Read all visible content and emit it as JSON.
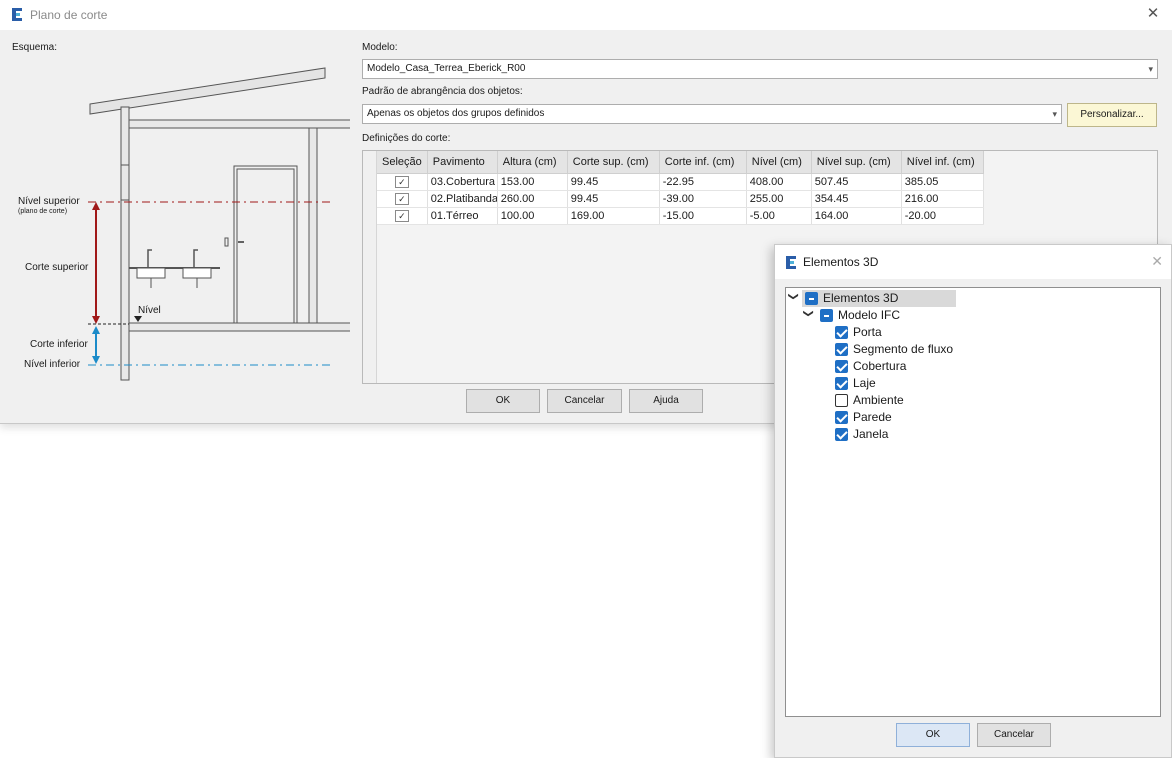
{
  "window": {
    "title": "Plano de corte",
    "close_glyph": "✕"
  },
  "schema": {
    "label": "Esquema:",
    "nivel_superior": "Nível superior",
    "plano_de_corte": "(plano de corte)",
    "corte_superior": "Corte superior",
    "nivel": "Nível",
    "corte_inferior": "Corte inferior",
    "nivel_inferior": "Nível inferior",
    "colors": {
      "superior": "#a01818",
      "inferior": "#1b8bc9"
    }
  },
  "modelo": {
    "label": "Modelo:",
    "value": "Modelo_Casa_Terrea_Eberick_R00"
  },
  "padrao": {
    "label": "Padrão de abrangência dos objetos:",
    "value": "Apenas os objetos dos grupos definidos",
    "personalizar": "Personalizar..."
  },
  "definicoes": {
    "label": "Definições do corte:",
    "columns": [
      "Seleção",
      "Pavimento",
      "Altura (cm)",
      "Corte sup. (cm)",
      "Corte inf. (cm)",
      "Nível (cm)",
      "Nível sup. (cm)",
      "Nível inf. (cm)"
    ],
    "rows": [
      {
        "selected": true,
        "pavimento": "03.Cobertura",
        "altura": "153.00",
        "corte_sup": "99.45",
        "corte_inf": "-22.95",
        "nivel": "408.00",
        "nivel_sup": "507.45",
        "nivel_inf": "385.05"
      },
      {
        "selected": true,
        "pavimento": "02.Platibanda",
        "altura": "260.00",
        "corte_sup": "99.45",
        "corte_inf": "-39.00",
        "nivel": "255.00",
        "nivel_sup": "354.45",
        "nivel_inf": "216.00"
      },
      {
        "selected": true,
        "pavimento": "01.Térreo",
        "altura": "100.00",
        "corte_sup": "169.00",
        "corte_inf": "-15.00",
        "nivel": "-5.00",
        "nivel_sup": "164.00",
        "nivel_inf": "-20.00"
      }
    ]
  },
  "buttons": {
    "ok": "OK",
    "cancelar": "Cancelar",
    "ajuda": "Ajuda"
  },
  "elementos3d": {
    "title": "Elementos 3D",
    "close_glyph": "✕",
    "root": "Elementos 3D",
    "group": "Modelo IFC",
    "items": [
      {
        "label": "Porta",
        "checked": true
      },
      {
        "label": "Segmento de fluxo",
        "checked": true
      },
      {
        "label": "Cobertura",
        "checked": true
      },
      {
        "label": "Laje",
        "checked": true
      },
      {
        "label": "Ambiente",
        "checked": false
      },
      {
        "label": "Parede",
        "checked": true
      },
      {
        "label": "Janela",
        "checked": true
      }
    ],
    "ok": "OK",
    "cancelar": "Cancelar"
  }
}
